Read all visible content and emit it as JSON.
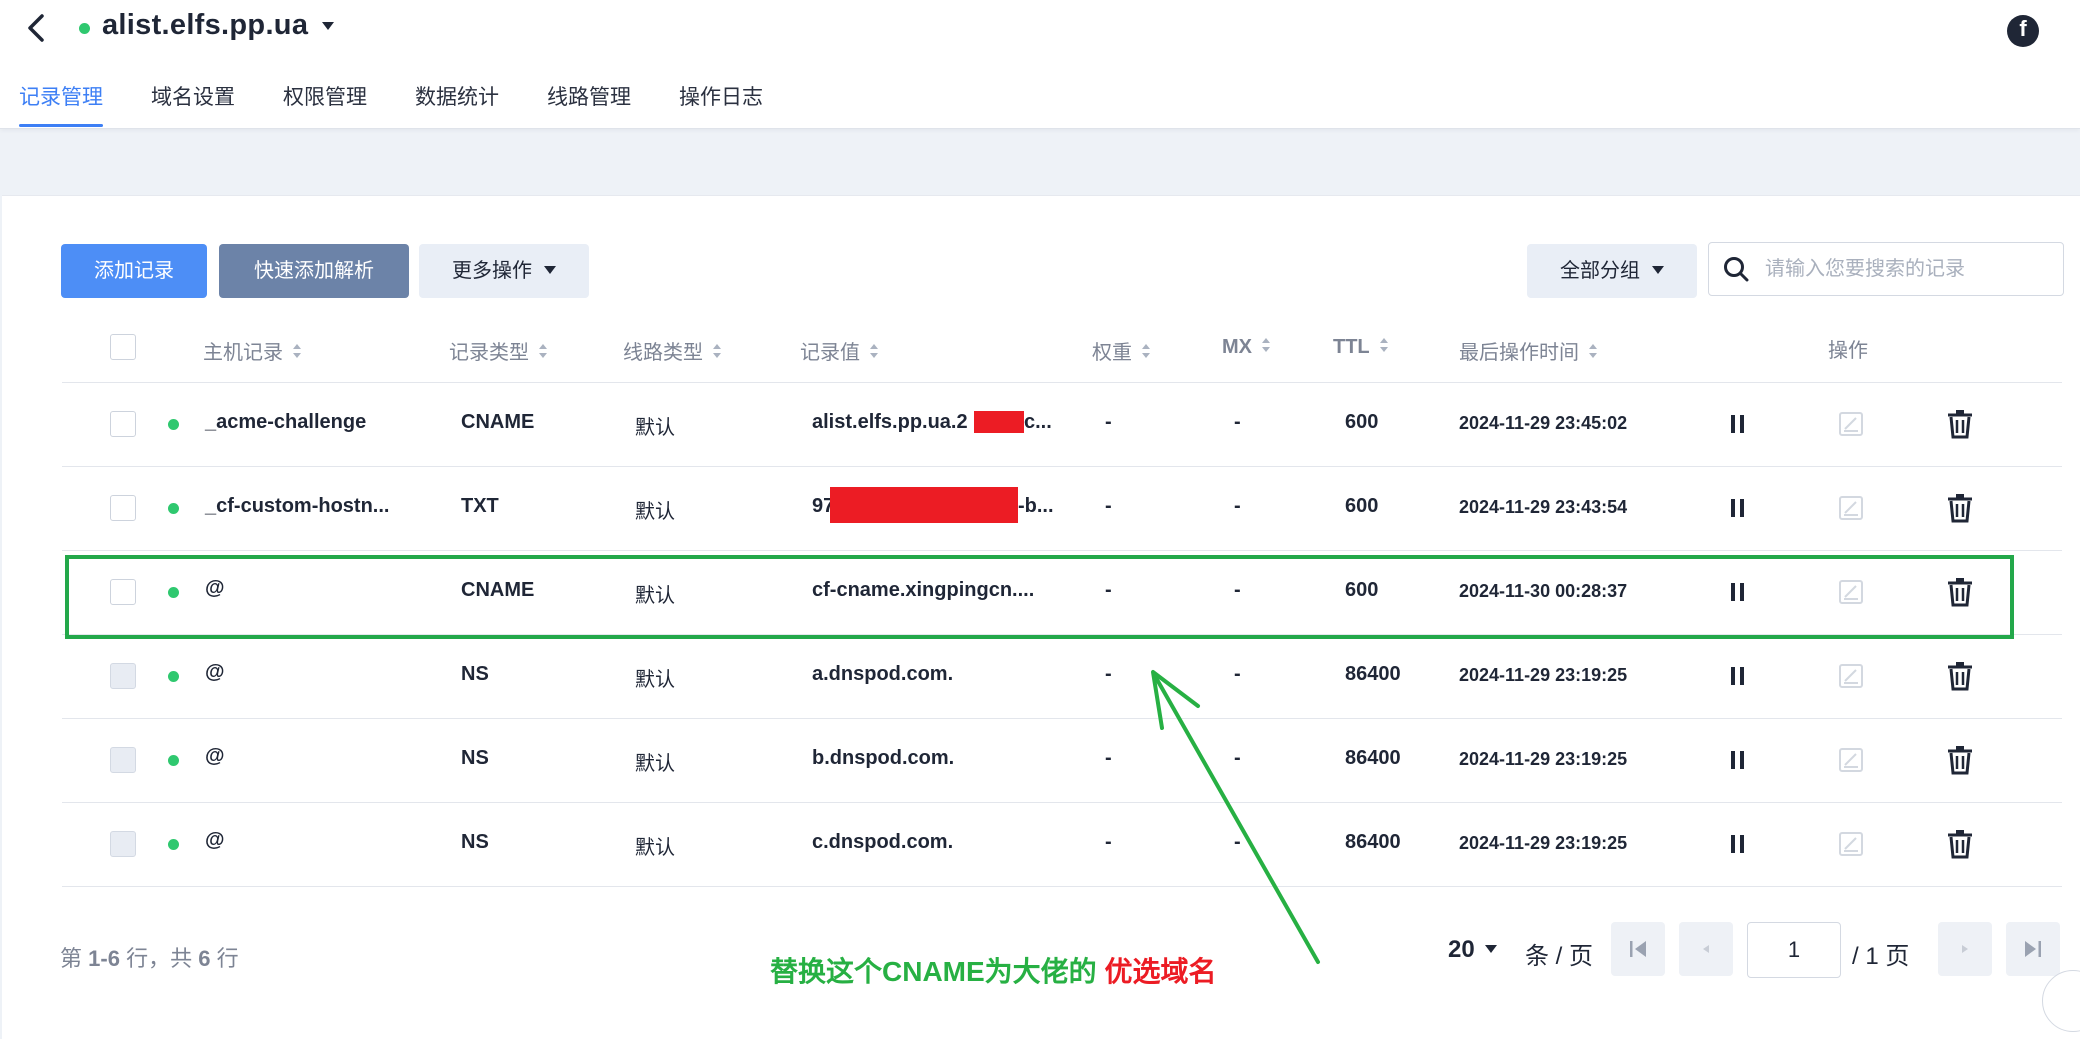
{
  "header": {
    "domain": "alist.elfs.pp.ua",
    "social_icon": "facebook-icon"
  },
  "tabs": [
    {
      "label": "记录管理",
      "active": true
    },
    {
      "label": "域名设置",
      "active": false
    },
    {
      "label": "权限管理",
      "active": false
    },
    {
      "label": "数据统计",
      "active": false
    },
    {
      "label": "线路管理",
      "active": false
    },
    {
      "label": "操作日志",
      "active": false
    }
  ],
  "toolbar": {
    "add_record": "添加记录",
    "quick_add": "快速添加解析",
    "more_actions": "更多操作",
    "group_filter": "全部分组",
    "search_placeholder": "请输入您要搜索的记录"
  },
  "table": {
    "columns": {
      "host": "主机记录",
      "type": "记录类型",
      "line": "线路类型",
      "value": "记录值",
      "weight": "权重",
      "mx": "MX",
      "ttl": "TTL",
      "last_op": "最后操作时间",
      "actions": "操作"
    },
    "rows": [
      {
        "host": "_acme-challenge",
        "type": "CNAME",
        "line": "默认",
        "value_prefix": "alist.elfs.pp.ua.2",
        "value_suffix": "c...",
        "weight": "-",
        "mx": "-",
        "ttl": "600",
        "time": "2024-11-29 23:45:02"
      },
      {
        "host": "_cf-custom-hostn...",
        "type": "TXT",
        "line": "默认",
        "value_prefix": "97",
        "value_suffix": "-b...",
        "weight": "-",
        "mx": "-",
        "ttl": "600",
        "time": "2024-11-29 23:43:54"
      },
      {
        "host": "@",
        "type": "CNAME",
        "line": "默认",
        "value_prefix": "cf-cname.xingpingcn....",
        "value_suffix": "",
        "weight": "-",
        "mx": "-",
        "ttl": "600",
        "time": "2024-11-30 00:28:37"
      },
      {
        "host": "@",
        "type": "NS",
        "line": "默认",
        "value_prefix": "a.dnspod.com.",
        "value_suffix": "",
        "weight": "-",
        "mx": "-",
        "ttl": "86400",
        "time": "2024-11-29 23:19:25"
      },
      {
        "host": "@",
        "type": "NS",
        "line": "默认",
        "value_prefix": "b.dnspod.com.",
        "value_suffix": "",
        "weight": "-",
        "mx": "-",
        "ttl": "86400",
        "time": "2024-11-29 23:19:25"
      },
      {
        "host": "@",
        "type": "NS",
        "line": "默认",
        "value_prefix": "c.dnspod.com.",
        "value_suffix": "",
        "weight": "-",
        "mx": "-",
        "ttl": "86400",
        "time": "2024-11-29 23:19:25"
      }
    ]
  },
  "footer": {
    "count_prefix": "第",
    "count_range": "1-6",
    "count_mid": "行，共",
    "count_total": "6",
    "count_suffix": "行",
    "page_size": "20",
    "per_page": "条 / 页",
    "current_page": "1",
    "total_pages": "/ 1 页"
  },
  "annotation": {
    "text": "替换这个CNAME为大佬的",
    "highlight": "优选域名",
    "arrow_color": "#27b043"
  },
  "colors": {
    "accent": "#3d7ff5",
    "status_green": "#2fc86f",
    "annotation_green": "#27b043",
    "redaction_red": "#ec1c24"
  }
}
